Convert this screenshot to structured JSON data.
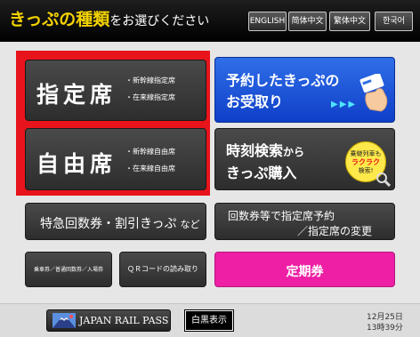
{
  "header": {
    "title_main": "きっぷの種類",
    "title_rest": "をお選びください",
    "languages": [
      "ENGLISH",
      "简体中文",
      "繁体中文",
      "한국어"
    ]
  },
  "reserved_seat": {
    "label": "指定席",
    "lines": [
      "・新幹線指定席",
      "・在来線指定席"
    ]
  },
  "unreserved_seat": {
    "label": "自由席",
    "lines": [
      "・新幹線自由席",
      "・在来線自由席"
    ]
  },
  "pickup": {
    "line1": "予約したきっぷの",
    "line2": "お受取り",
    "arrows": "▶▶▶"
  },
  "timetable": {
    "line1_main": "時刻検索",
    "line1_suffix": "から",
    "line2": "きっぷ購入",
    "badge_line1": "乗継列車も",
    "badge_line2": "ラクラク",
    "badge_line3": "検索!"
  },
  "coupon_discount": {
    "main": "特急回数券・割引きっぷ",
    "suffix": "など"
  },
  "coupon_reserve": {
    "line1": "回数券等で指定席予約",
    "line2": "／指定席の変更"
  },
  "small_buttons": {
    "boarding": "乗車券／普通回数券／入場券",
    "qr": "ＱＲコードの読み取り"
  },
  "commuter": {
    "label": "定期券"
  },
  "footer": {
    "jrp_label": "JAPAN RAIL PASS",
    "contrast": "白黒表示",
    "date": "12月25日",
    "time": "13時39分"
  },
  "colors": {
    "title_yellow": "#f3d200",
    "selection_red": "#e8141b",
    "blue_button": "#1f55dc",
    "magenta_button": "#ee1fa4"
  }
}
